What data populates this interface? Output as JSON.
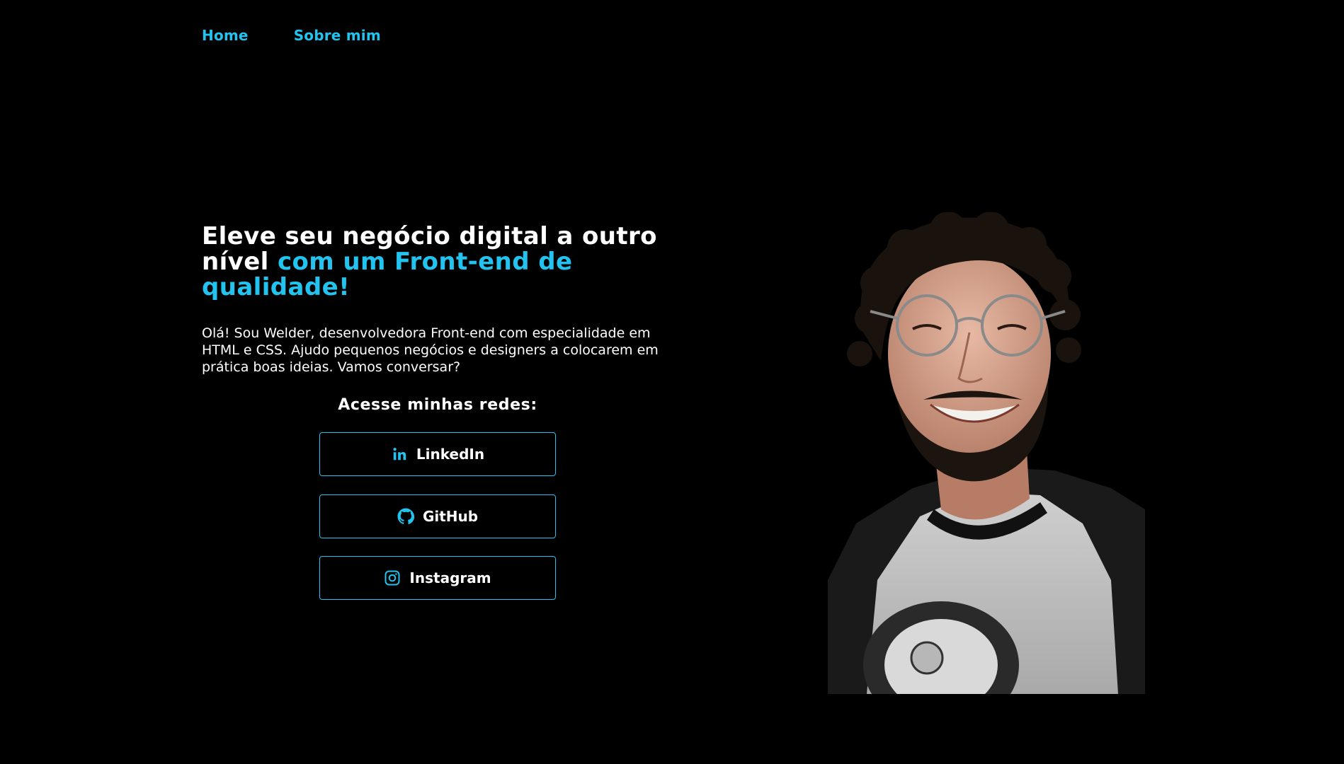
{
  "nav": {
    "items": [
      {
        "label": "Home"
      },
      {
        "label": "Sobre mim"
      }
    ]
  },
  "hero": {
    "headline_main": "Eleve seu negócio digital a outro nível ",
    "headline_accent": "com um Front-end de qualidade!",
    "intro": "Olá! Sou Welder, desenvolvedora Front-end com especialidade em HTML e CSS. Ajudo pequenos negócios e designers a colocarem em prática boas ideias. Vamos conversar?"
  },
  "social": {
    "title": "Acesse minhas redes:",
    "buttons": [
      {
        "label": "LinkedIn",
        "icon": "linkedin-icon"
      },
      {
        "label": "GitHub",
        "icon": "github-icon"
      },
      {
        "label": "Instagram",
        "icon": "instagram-icon"
      }
    ]
  },
  "colors": {
    "background": "#000000",
    "accent": "#22c3ef",
    "text": "#ffffff"
  }
}
